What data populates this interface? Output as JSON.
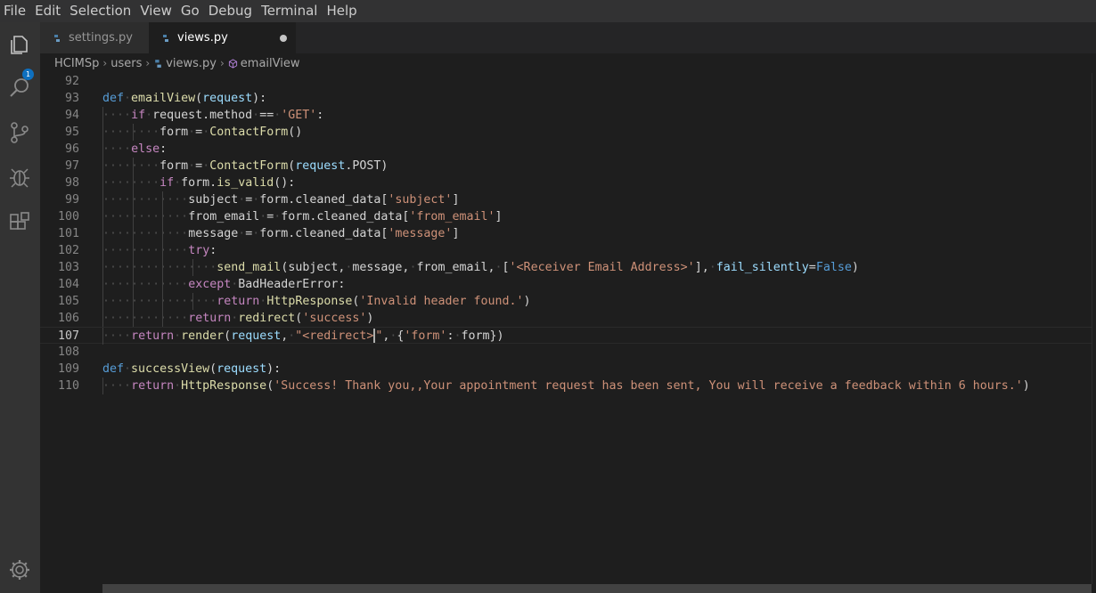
{
  "menu": [
    "File",
    "Edit",
    "Selection",
    "View",
    "Go",
    "Debug",
    "Terminal",
    "Help"
  ],
  "activity_bar": {
    "explorer_badge": "1",
    "icons": [
      "files-icon",
      "search-icon",
      "source-control-icon",
      "debug-icon",
      "extensions-icon",
      "settings-gear-icon"
    ]
  },
  "tabs": [
    {
      "label": "settings.py",
      "active": false
    },
    {
      "label": "views.py",
      "active": true,
      "dirty": true
    }
  ],
  "breadcrumbs": [
    "HCIMSp",
    "users",
    "views.py",
    "emailView"
  ],
  "editor": {
    "current_line": 107,
    "lines": [
      {
        "n": "92",
        "text": ""
      },
      {
        "n": "93",
        "text": "def emailView(request):"
      },
      {
        "n": "94",
        "text": "    if request.method == 'GET':"
      },
      {
        "n": "95",
        "text": "        form = ContactForm()"
      },
      {
        "n": "96",
        "text": "    else:"
      },
      {
        "n": "97",
        "text": "        form = ContactForm(request.POST)"
      },
      {
        "n": "98",
        "text": "        if form.is_valid():"
      },
      {
        "n": "99",
        "text": "            subject = form.cleaned_data['subject']"
      },
      {
        "n": "100",
        "text": "            from_email = form.cleaned_data['from_email']"
      },
      {
        "n": "101",
        "text": "            message = form.cleaned_data['message']"
      },
      {
        "n": "102",
        "text": "            try:"
      },
      {
        "n": "103",
        "text": "                send_mail(subject, message, from_email, ['<Receiver Email Address>'], fail_silently=False)"
      },
      {
        "n": "104",
        "text": "            except BadHeaderError:"
      },
      {
        "n": "105",
        "text": "                return HttpResponse('Invalid header found.')"
      },
      {
        "n": "106",
        "text": "            return redirect('success')"
      },
      {
        "n": "107",
        "text": "    return render(request, \"<redirect>\", {'form': form})"
      },
      {
        "n": "108",
        "text": ""
      },
      {
        "n": "109",
        "text": "def successView(request):"
      },
      {
        "n": "110",
        "text": "    return HttpResponse('Success! Thank you,,Your appointment request has been sent, You will receive a feedback within 6 hours.')"
      }
    ]
  },
  "colors": {
    "keyword": "#569cd6",
    "control": "#c586c0",
    "function": "#dcdcaa",
    "param": "#9cdcfe",
    "string": "#ce9178",
    "text": "#d4d4d4",
    "badge": "#0e70c0"
  }
}
